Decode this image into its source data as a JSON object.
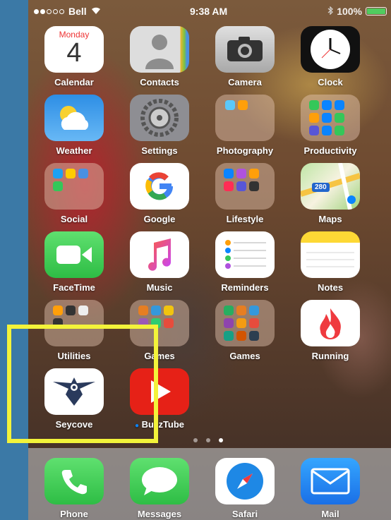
{
  "status": {
    "carrier": "Bell",
    "time": "9:38 AM",
    "battery": "100%"
  },
  "apps": [
    {
      "label": "Calendar",
      "icon": "calendar-icon",
      "day": "Monday",
      "date": "4"
    },
    {
      "label": "Contacts",
      "icon": "contacts-icon"
    },
    {
      "label": "Camera",
      "icon": "camera-icon"
    },
    {
      "label": "Clock",
      "icon": "clock-icon"
    },
    {
      "label": "Weather",
      "icon": "weather-icon"
    },
    {
      "label": "Settings",
      "icon": "settings-icon"
    },
    {
      "label": "Photography",
      "icon": "folder-icon"
    },
    {
      "label": "Productivity",
      "icon": "folder-icon"
    },
    {
      "label": "Social",
      "icon": "folder-icon"
    },
    {
      "label": "Google",
      "icon": "google-icon"
    },
    {
      "label": "Lifestyle",
      "icon": "folder-icon"
    },
    {
      "label": "Maps",
      "icon": "maps-icon",
      "road": "280"
    },
    {
      "label": "FaceTime",
      "icon": "facetime-icon"
    },
    {
      "label": "Music",
      "icon": "music-icon"
    },
    {
      "label": "Reminders",
      "icon": "reminders-icon"
    },
    {
      "label": "Notes",
      "icon": "notes-icon"
    },
    {
      "label": "Utilities",
      "icon": "folder-icon"
    },
    {
      "label": "Games",
      "icon": "folder-icon"
    },
    {
      "label": "Games",
      "icon": "folder-icon"
    },
    {
      "label": "Running",
      "icon": "flame-icon"
    },
    {
      "label": "Seycove",
      "icon": "eagle-logo-icon"
    },
    {
      "label": "BuzzTube",
      "icon": "play-icon"
    }
  ],
  "dock": [
    {
      "label": "Phone",
      "icon": "phone-icon"
    },
    {
      "label": "Messages",
      "icon": "messages-icon"
    },
    {
      "label": "Safari",
      "icon": "compass-icon"
    },
    {
      "label": "Mail",
      "icon": "mail-icon"
    }
  ],
  "page_indicator": {
    "count": 3,
    "active": 2
  },
  "colors": {
    "highlight": "#f3f33a",
    "background": "#3b79a6"
  }
}
